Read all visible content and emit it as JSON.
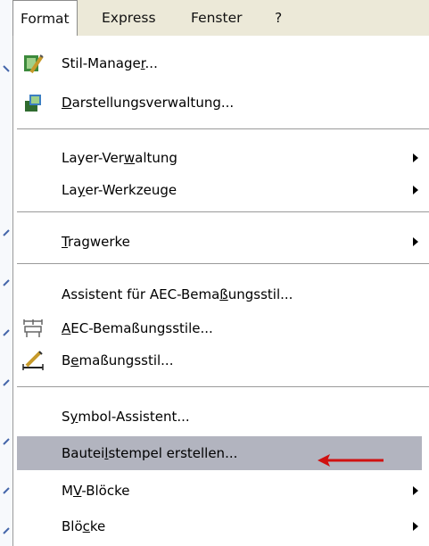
{
  "menubar": {
    "items": [
      {
        "label": "Format"
      },
      {
        "label": "Express"
      },
      {
        "label": "Fenster"
      },
      {
        "label": "?"
      }
    ]
  },
  "menu": {
    "items": [
      {
        "pre": "Stil-Manage",
        "u": "r",
        "post": "...",
        "icon": "style-manager-icon"
      },
      {
        "pre": "",
        "u": "D",
        "post": "arstellungsverwaltung...",
        "icon": "display-manager-icon"
      },
      {
        "pre": "Layer-Ver",
        "u": "w",
        "post": "altung"
      },
      {
        "pre": "La",
        "u": "y",
        "post": "er-Werkzeuge"
      },
      {
        "pre": "",
        "u": "T",
        "post": "ragwerke"
      },
      {
        "pre": "Assistent für AEC-Bema",
        "u": "ß",
        "post": "ungsstil..."
      },
      {
        "pre": "",
        "u": "A",
        "post": "EC-Bemaßungsstile...",
        "icon": "aec-dimension-styles-icon"
      },
      {
        "pre": "B",
        "u": "e",
        "post": "maßungsstil...",
        "icon": "dimension-style-icon"
      },
      {
        "pre": "S",
        "u": "y",
        "post": "mbol-Assistent..."
      },
      {
        "pre": "Bautei",
        "u": "l",
        "post": "stempel erstellen..."
      },
      {
        "pre": "M",
        "u": "V",
        "post": "-Blöcke"
      },
      {
        "pre": "Blö",
        "u": "c",
        "post": "ke"
      }
    ]
  },
  "colors": {
    "highlight": "#b2b4bf",
    "annotation_arrow": "#d01010"
  }
}
